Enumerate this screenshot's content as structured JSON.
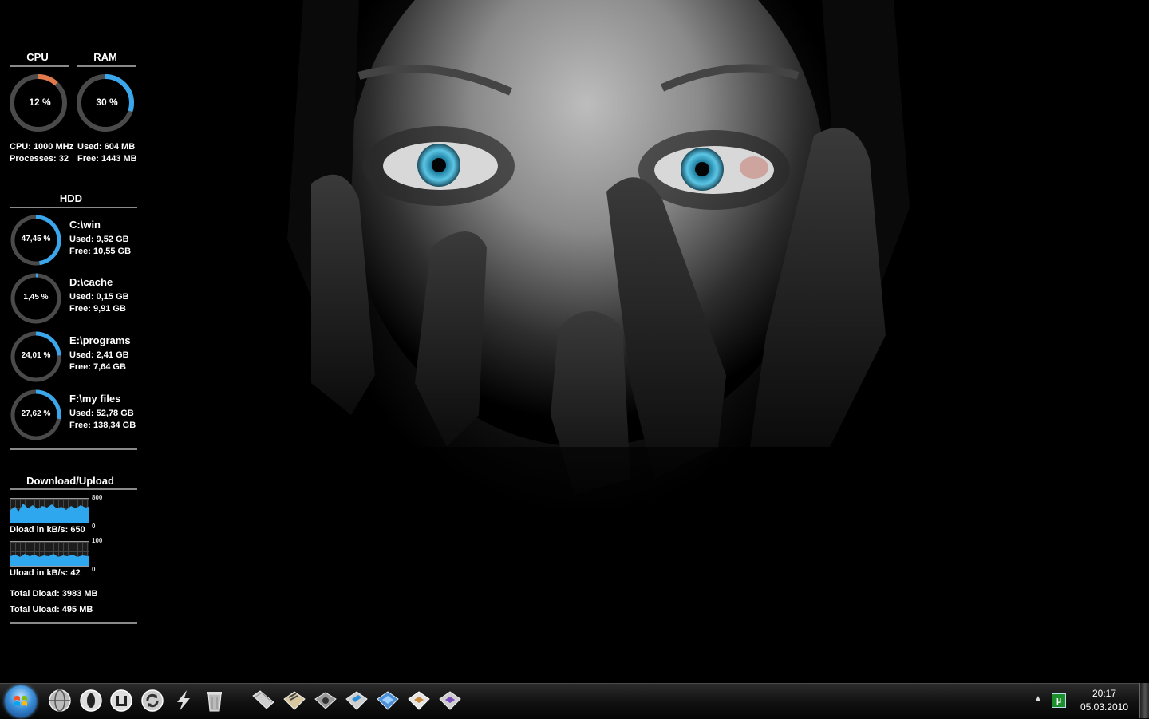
{
  "gadget": {
    "cpu": {
      "title": "CPU",
      "percent_label": "12 %",
      "percent": 12,
      "freq": "CPU: 1000 MHz",
      "processes": "Processes: 32",
      "ring_color": "#e07a4a"
    },
    "ram": {
      "title": "RAM",
      "percent_label": "30 %",
      "percent": 30,
      "used": "Used: 604 MB",
      "free": "Free: 1443 MB",
      "ring_color": "#3aa6ec"
    },
    "hdd": {
      "title": "HDD",
      "drives": [
        {
          "percent_label": "47,45 %",
          "percent": 47.45,
          "name": "C:\\win",
          "used": "Used: 9,52 GB",
          "free": "Free:  10,55 GB"
        },
        {
          "percent_label": "1,45 %",
          "percent": 1.45,
          "name": "D:\\cache",
          "used": "Used: 0,15 GB",
          "free": "Free:  9,91 GB"
        },
        {
          "percent_label": "24,01 %",
          "percent": 24.01,
          "name": "E:\\programs",
          "used": "Used: 2,41 GB",
          "free": "Free:  7,64 GB"
        },
        {
          "percent_label": "27,62 %",
          "percent": 27.62,
          "name": "F:\\my files",
          "used": "Used: 52,78 GB",
          "free": "Free:  138,34 GB"
        }
      ]
    },
    "network": {
      "title": "Download/Upload",
      "dload_label": "Dload in kB/s: 650",
      "dload_max": "800",
      "dload_min": "0",
      "uload_label": "Uload in kB/s: 42",
      "uload_max": "100",
      "uload_min": "0",
      "total_dload": "Total Dload: 3983 MB",
      "total_uload": "Total Uload: 495 MB"
    }
  },
  "taskbar": {
    "pinned_icons": [
      "globe-icon",
      "opera-icon",
      "unreal-icon",
      "refresh-icon",
      "winamp-icon",
      "recycle-bin-icon",
      "folder-icon",
      "folder-icon",
      "drive-icon",
      "folder-icon",
      "folder-icon",
      "folder-icon",
      "folder-icon"
    ],
    "tray": {
      "utorrent_icon": "µ"
    },
    "clock": {
      "time": "20:17",
      "date": "05.03.2010"
    }
  },
  "colors": {
    "accent": "#3aa6ec",
    "cpu": "#e07a4a",
    "ring_track": "#4a4a4a"
  }
}
